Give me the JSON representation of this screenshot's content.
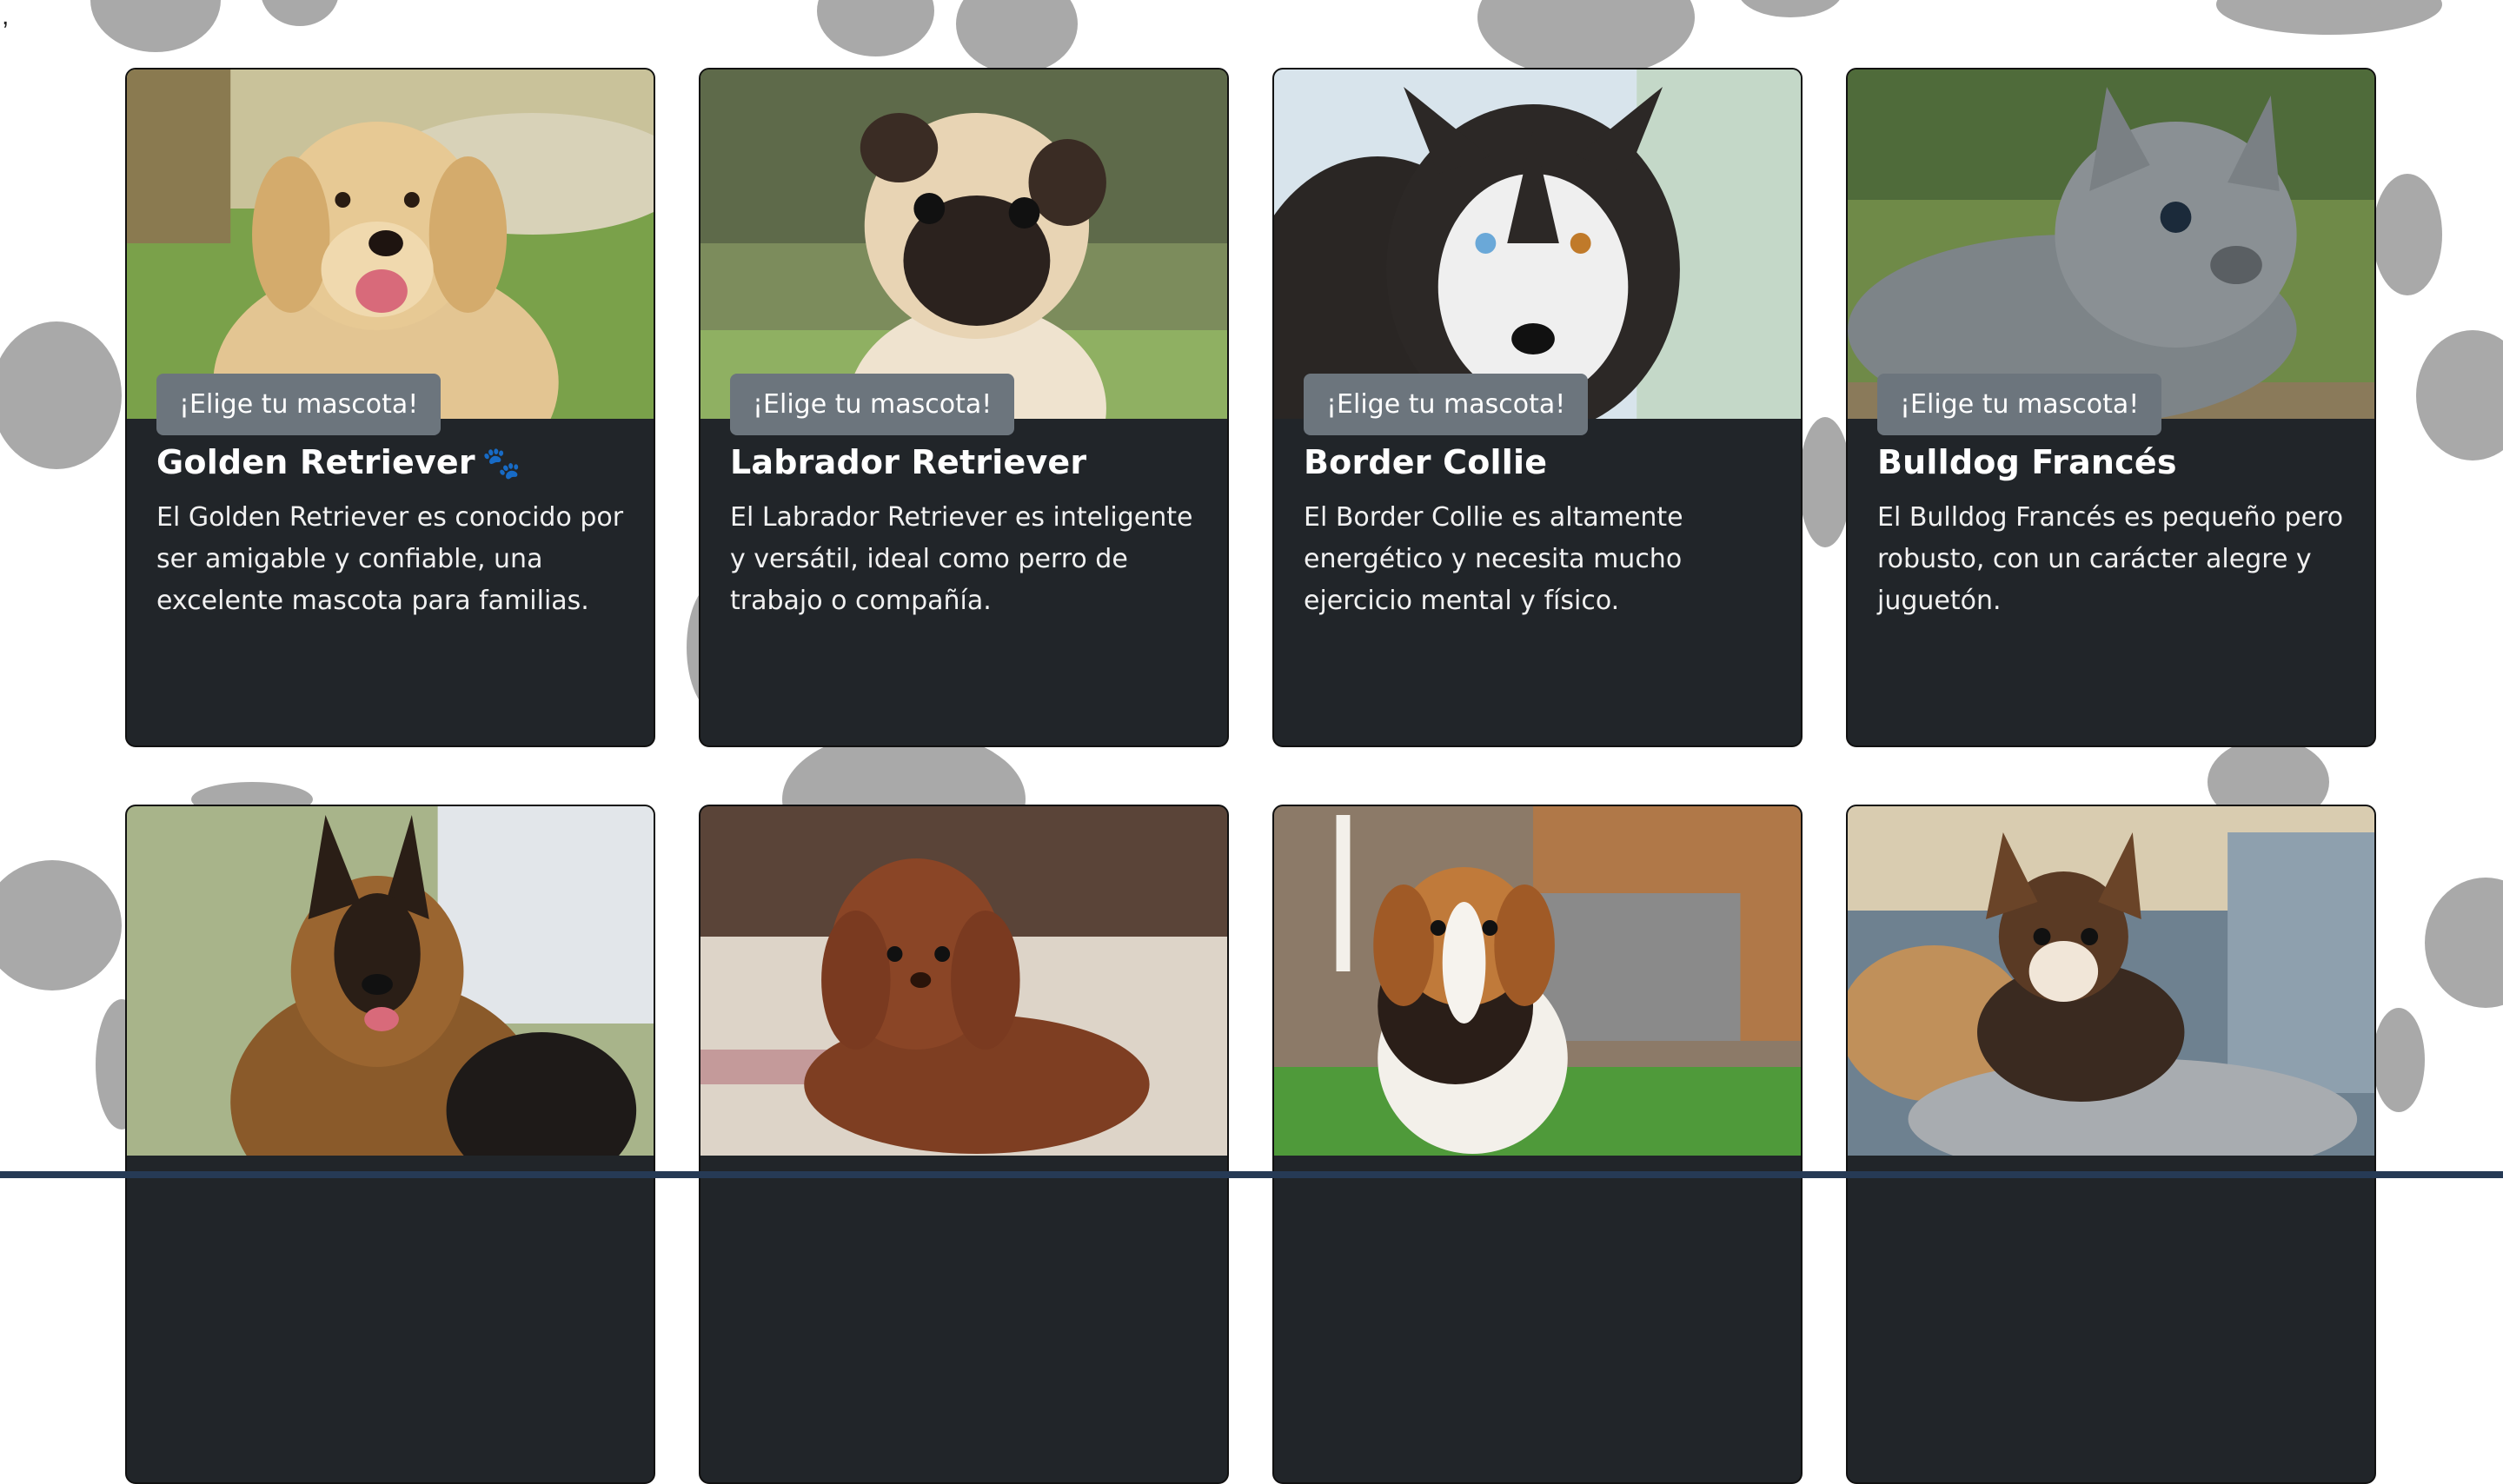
{
  "stray_char": ",",
  "button_label": "¡Elige tu mascota!",
  "colors": {
    "card_bg": "#212529",
    "button_bg": "#6c757d",
    "paw_print": "#a9a9a9"
  },
  "cards": [
    {
      "title": "Golden Retriever",
      "has_paw_icon": true,
      "paw_icon": "🐾",
      "text": "El Golden Retriever es conocido por ser amigable y confiable, una excelente mascota para familias.",
      "image": "golden-retriever-photo"
    },
    {
      "title": "Labrador Retriever",
      "text": "El Labrador Retriever es inteligente y versátil, ideal como perro de trabajo o compañía.",
      "image": "pug-photo"
    },
    {
      "title": "Border Collie",
      "text": "El Border Collie es altamente energético y necesita mucho ejercicio mental y físico.",
      "image": "husky-photo"
    },
    {
      "title": "Bulldog Francés",
      "text": "El Bulldog Francés es pequeño pero robusto, con un carácter alegre y juguetón.",
      "image": "french-bulldog-photo"
    },
    {
      "image": "german-shepherd-photo"
    },
    {
      "image": "poodle-photo"
    },
    {
      "image": "beagle-photo"
    },
    {
      "image": "chihuahua-photo"
    }
  ]
}
